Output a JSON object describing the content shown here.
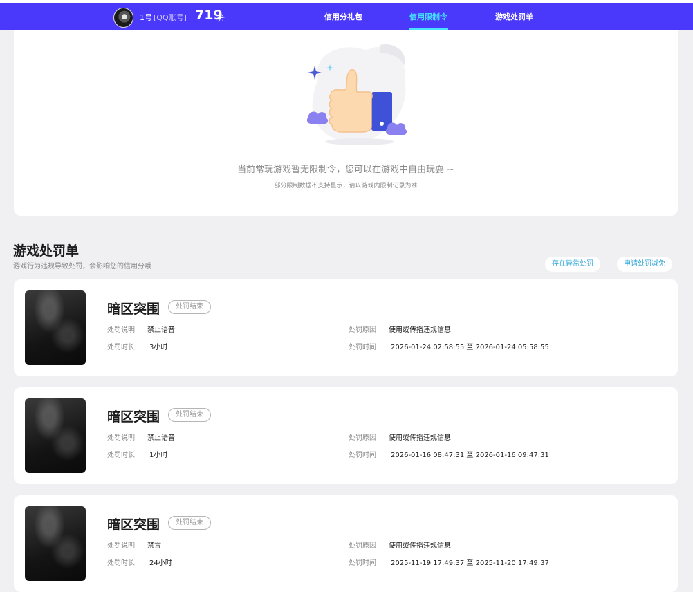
{
  "header": {
    "account_name": "1号",
    "account_type": "[QQ账号]",
    "score": "719",
    "score_unit": "分",
    "nav": [
      {
        "label": "信用分礼包",
        "active": false
      },
      {
        "label": "信用限制令",
        "active": true
      },
      {
        "label": "游戏处罚单",
        "active": false
      }
    ],
    "colors": {
      "bar": "#4a38fb",
      "active": "#45e1ff"
    }
  },
  "restriction": {
    "empty_message": "当前常玩游戏暂无限制令，您可以在游戏中自由玩耍 ~",
    "empty_note": "部分限制数据不支持显示，请以游戏内限制记录为准",
    "illustration": "thumbs-up-icon"
  },
  "penalty_section": {
    "title": "游戏处罚单",
    "subtitle": "游戏行为违规导致处罚，会影响您的信用分哦",
    "buttons": {
      "abnormal": "存在异常处罚",
      "appeal": "申请处罚减免"
    }
  },
  "labels": {
    "description": "处罚说明",
    "duration": "处罚时长",
    "reason": "处罚原因",
    "time": "处罚时间",
    "to": "至"
  },
  "penalties": [
    {
      "game": "暗区突围",
      "status": "处罚结束",
      "description": "禁止语音",
      "duration": "3小时",
      "reason": "使用或传播违规信息",
      "start": "2026-01-24 02:58:55",
      "end": "2026-01-24 05:58:55"
    },
    {
      "game": "暗区突围",
      "status": "处罚结束",
      "description": "禁止语音",
      "duration": "1小时",
      "reason": "使用或传播违规信息",
      "start": "2026-01-16 08:47:31",
      "end": "2026-01-16 09:47:31"
    },
    {
      "game": "暗区突围",
      "status": "处罚结束",
      "description": "禁言",
      "duration": "24小时",
      "reason": "使用或传播违规信息",
      "start": "2025-11-19 17:49:37",
      "end": "2025-11-20 17:49:37"
    }
  ]
}
